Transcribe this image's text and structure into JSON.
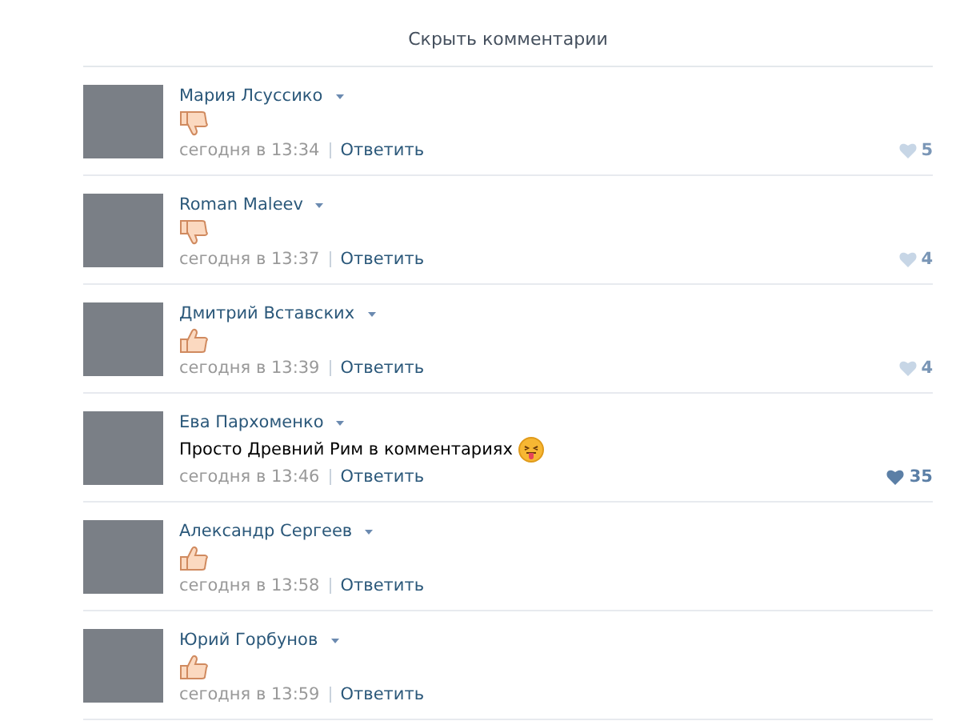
{
  "hide_link": "Скрыть комментарии",
  "comments": [
    {
      "author": "Мария Лсуссико",
      "kind": "thumbs-down",
      "time": "сегодня в 13:34",
      "reply": "Ответить",
      "likes": "5",
      "liked": false
    },
    {
      "author": "Roman Maleev",
      "kind": "thumbs-down",
      "time": "сегодня в 13:37",
      "reply": "Ответить",
      "likes": "4",
      "liked": false
    },
    {
      "author": "Дмитрий Вставских",
      "kind": "thumbs-up",
      "time": "сегодня в 13:39",
      "reply": "Ответить",
      "likes": "4",
      "liked": false
    },
    {
      "author": "Ева Пархоменко",
      "kind": "text",
      "text": "Просто Древний Рим в комментариях",
      "emoji": true,
      "time": "сегодня в 13:46",
      "reply": "Ответить",
      "likes": "35",
      "liked": true
    },
    {
      "author": "Александр Сергеев",
      "kind": "thumbs-up",
      "time": "сегодня в 13:58",
      "reply": "Ответить"
    },
    {
      "author": "Юрий Горбунов",
      "kind": "thumbs-up",
      "time": "сегодня в 13:59",
      "reply": "Ответить"
    }
  ]
}
